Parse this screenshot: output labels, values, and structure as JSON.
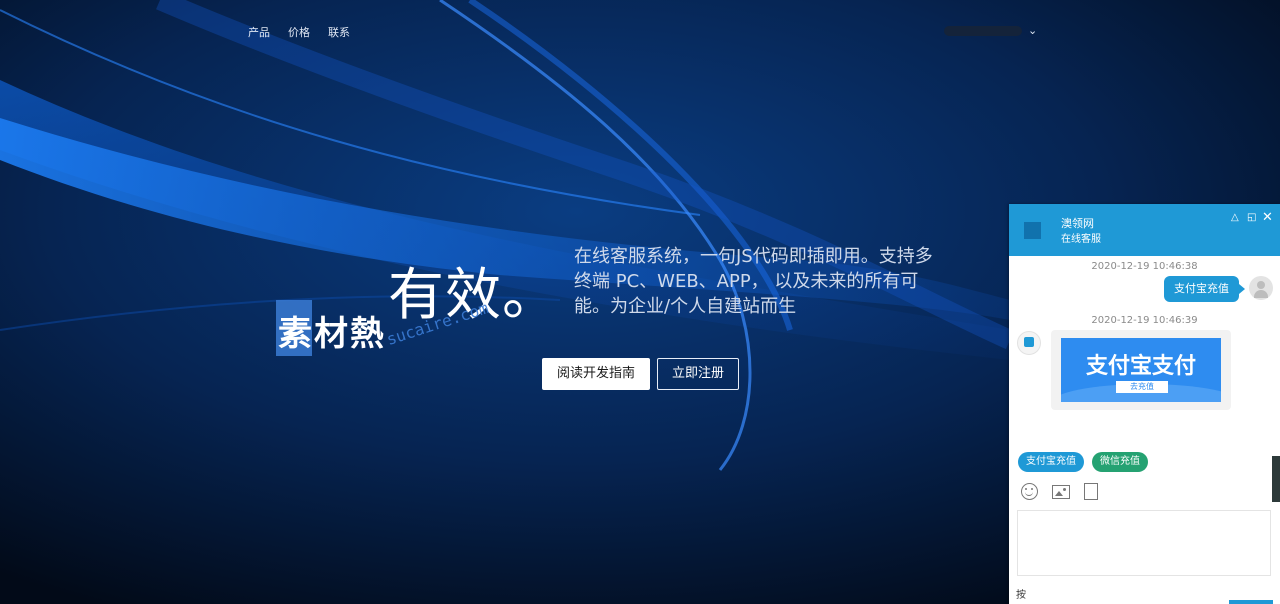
{
  "nav": {
    "items": [
      "产品",
      "价格",
      "联系"
    ]
  },
  "hero": {
    "headline": "有效。",
    "subtitle": "在线客服系统，一句JS代码即插即用。支持多终端 PC、WEB、APP， 以及未来的所有可能。为企业/个人自建站而生",
    "buttons": {
      "read": "阅读开发指南",
      "register": "立即注册"
    }
  },
  "watermark": {
    "cn": "素材熱",
    "en": "sucaire.com"
  },
  "chat": {
    "header": {
      "title": "澳领网",
      "status": "在线客服"
    },
    "messages": [
      {
        "time": "2020-12-19 10:46:38",
        "text": "支付宝充值"
      },
      {
        "time": "2020-12-19 10:46:39",
        "card_title": "支付宝支付",
        "card_button": "去充值"
      }
    ],
    "quick_replies": [
      "支付宝充值",
      "微信充值"
    ],
    "input_hint": "按"
  },
  "colors": {
    "accent": "#1f99d6",
    "wechat": "#25a272",
    "background": "#03122a"
  }
}
